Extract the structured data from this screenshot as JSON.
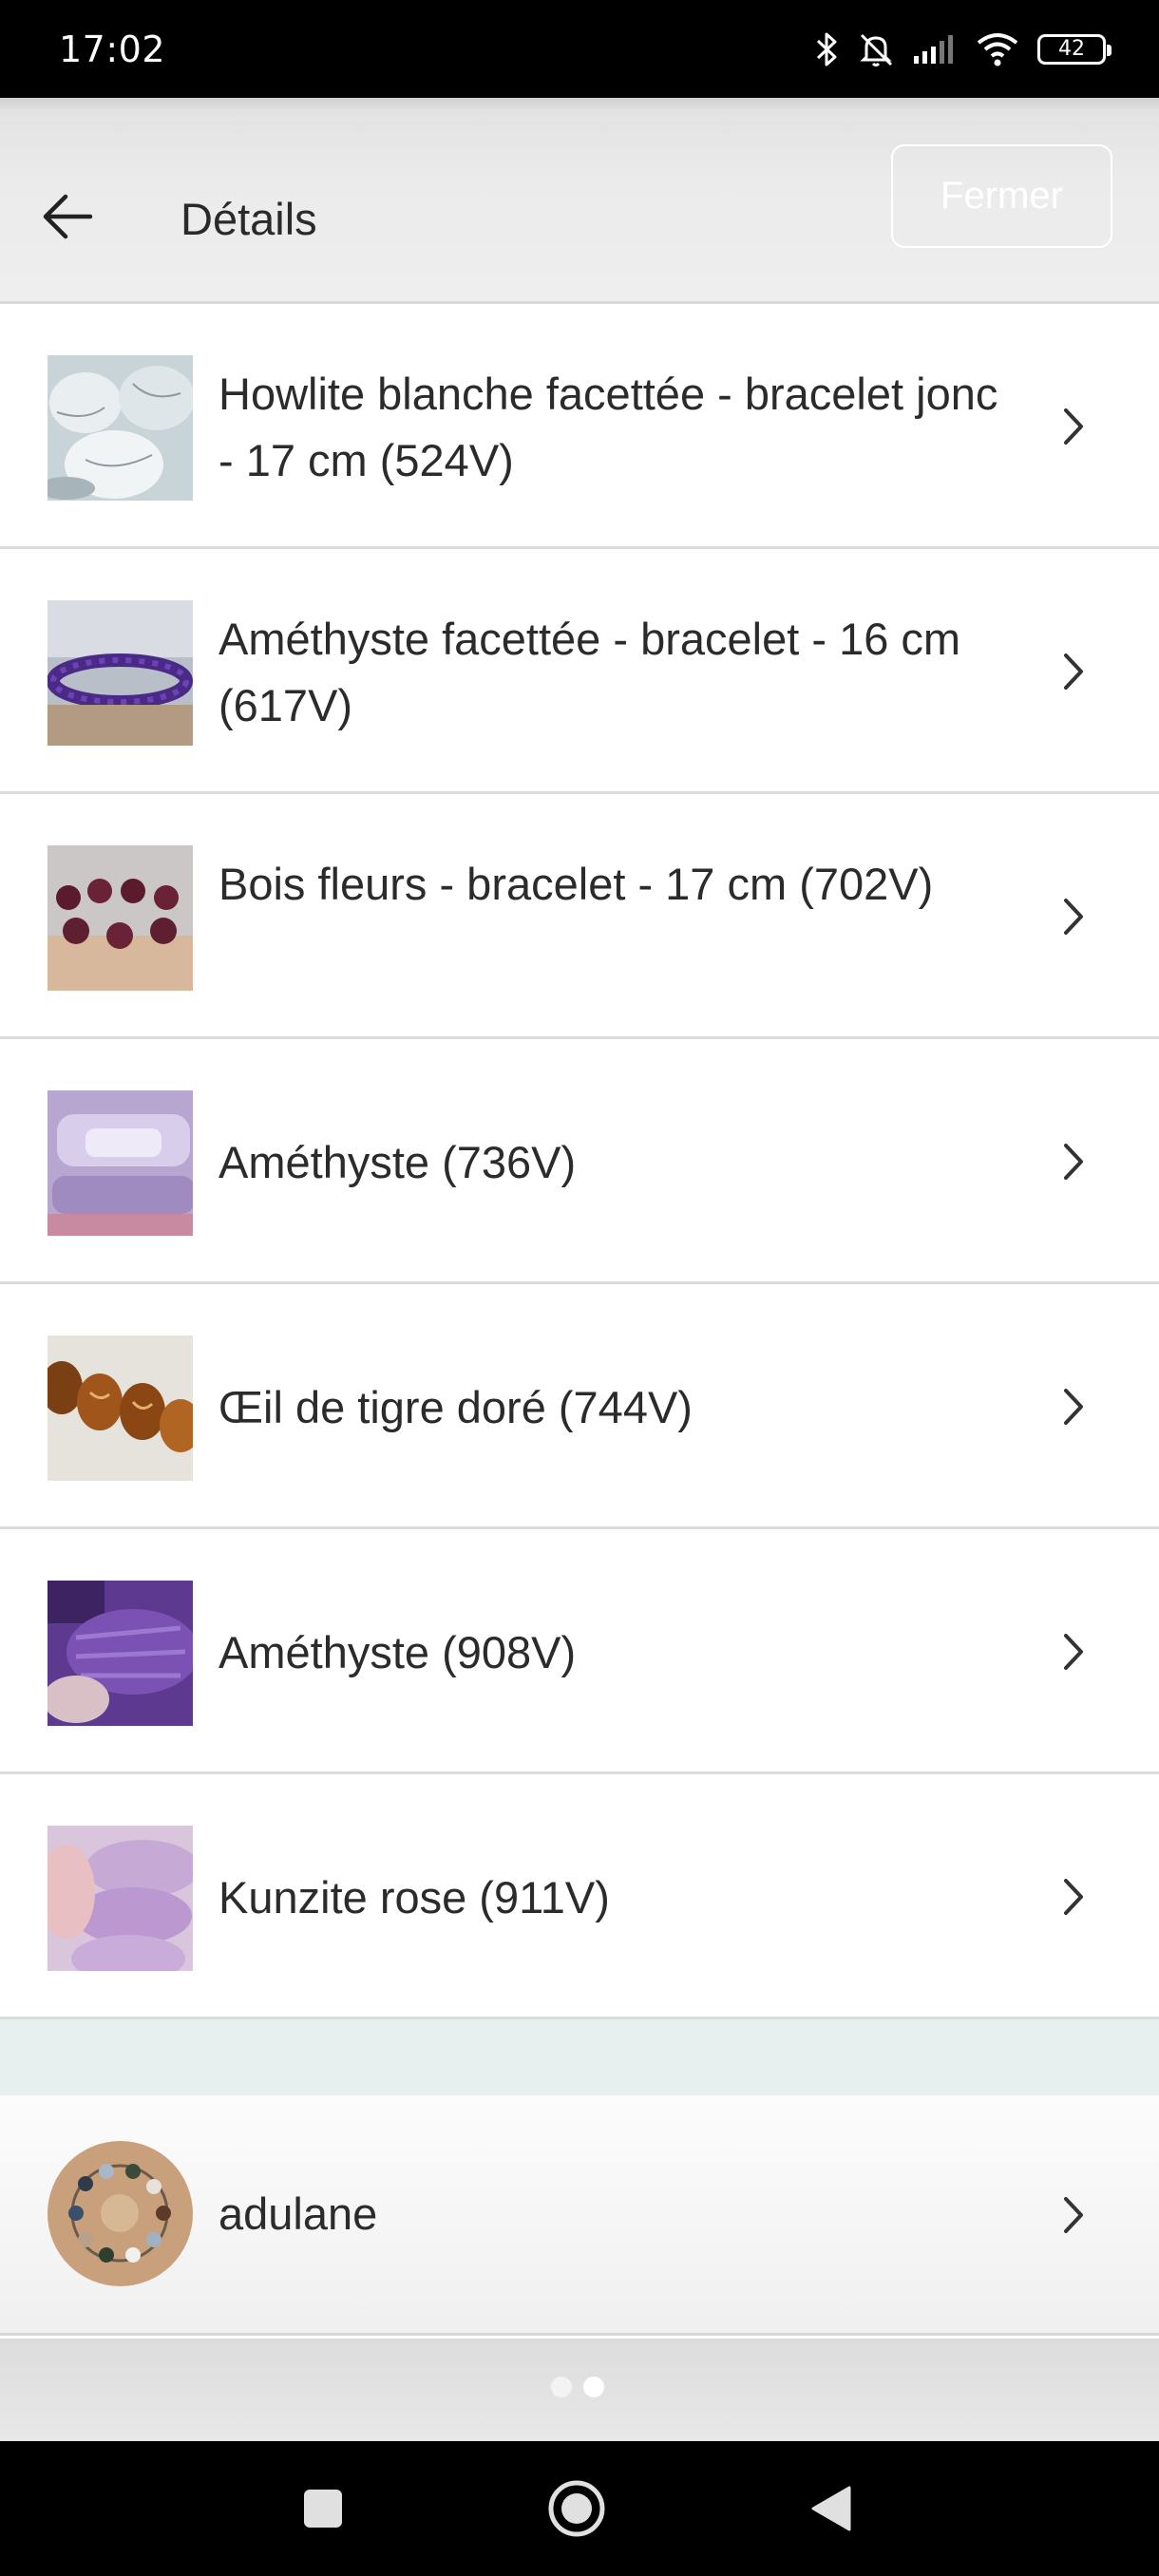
{
  "status_bar": {
    "time": "17:02",
    "battery": "42",
    "icons": [
      "bluetooth-icon",
      "bell-off-icon",
      "signal-icon",
      "wifi-icon",
      "battery-icon"
    ]
  },
  "header": {
    "title": "Détails",
    "close_label": "Fermer",
    "back_icon": "arrow-left-icon"
  },
  "items": [
    {
      "label": "Howlite blanche facettée - bracelet jonc - 17 cm (524V)",
      "thumb": "white-howlite-bracelet"
    },
    {
      "label": "Améthyste facettée - bracelet - 16 cm (617V)",
      "thumb": "amethyst-bead-bracelet"
    },
    {
      "label": "Bois fleurs - bracelet - 17 cm (702V)",
      "thumb": "wood-flower-bracelet"
    },
    {
      "label": "Améthyste (736V)",
      "thumb": "amethyst-bar-bracelet"
    },
    {
      "label": "Œil de tigre doré (744V)",
      "thumb": "tiger-eye-bracelet"
    },
    {
      "label": "Améthyste (908V)",
      "thumb": "amethyst-tube-bracelet"
    },
    {
      "label": "Kunzite rose (911V)",
      "thumb": "pink-kunzite-bracelet"
    }
  ],
  "seller": {
    "name": "adulane",
    "avatar": "bead-circle-avatar"
  },
  "pager": {
    "total": 2,
    "active": 2
  },
  "colors": {
    "status_bar": "#000000",
    "header_bg": "#ebebeb",
    "divider": "#dcdcdc",
    "section_gap": "#e8efef",
    "text": "#2b2b2b"
  }
}
